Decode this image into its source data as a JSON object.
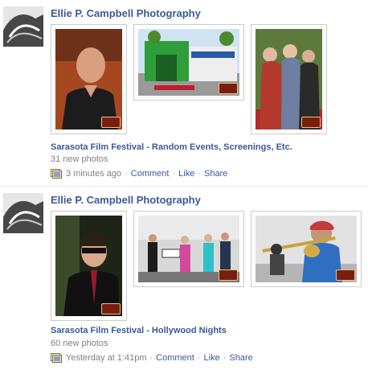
{
  "stories": [
    {
      "author": "Ellie P. Campbell Photography",
      "album_title": "Sarasota Film Festival - Random Events, Screenings, Etc.",
      "photo_count": "31 new photos",
      "time": "3 minutes ago",
      "actions": [
        "Comment",
        "Like",
        "Share"
      ],
      "photos": [
        "photo-man-portrait",
        "photo-storefront",
        "photo-women-group"
      ]
    },
    {
      "author": "Ellie P. Campbell Photography",
      "album_title": "Sarasota Film Festival - Hollywood Nights",
      "photo_count": "60 new photos",
      "time": "Yesterday at 1:41pm",
      "actions": [
        "Comment",
        "Like",
        "Share"
      ],
      "photos": [
        "photo-man-sunglasses",
        "photo-band-stage",
        "photo-trombone-player"
      ]
    }
  ],
  "separator": "·",
  "colors": {
    "link": "#3b5998",
    "muted": "#808080"
  }
}
